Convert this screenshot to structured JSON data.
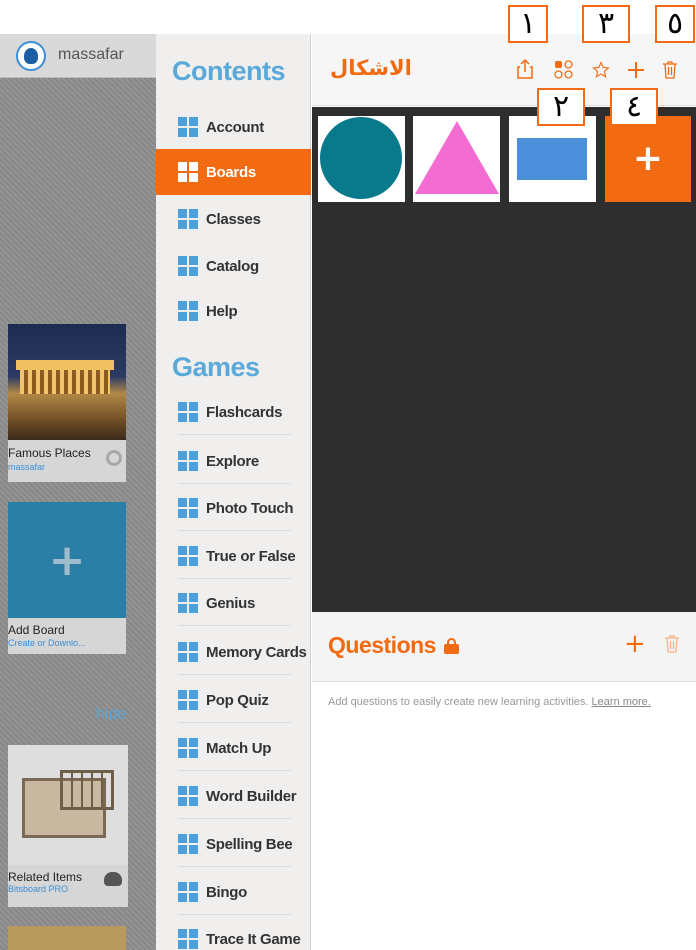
{
  "sidebar": {
    "username": "massafar",
    "boards": [
      {
        "title": "Famous Places",
        "subtitle": "massafar"
      },
      {
        "title": "Add Board",
        "subtitle": "Create or Downlo..."
      },
      {
        "title": "Related Items",
        "subtitle": "Bitsboard PRO"
      }
    ],
    "hide_label": "hide"
  },
  "menu": {
    "contents_title": "Contents",
    "contents_items": [
      {
        "label": "Account",
        "active": false
      },
      {
        "label": "Boards",
        "active": true
      },
      {
        "label": "Classes",
        "active": false
      },
      {
        "label": "Catalog",
        "active": false
      },
      {
        "label": "Help",
        "active": false
      }
    ],
    "games_title": "Games",
    "games_items": [
      {
        "label": "Flashcards"
      },
      {
        "label": "Explore"
      },
      {
        "label": "Photo Touch"
      },
      {
        "label": "True or False"
      },
      {
        "label": "Genius"
      },
      {
        "label": "Memory Cards"
      },
      {
        "label": "Pop Quiz"
      },
      {
        "label": "Match Up"
      },
      {
        "label": "Word Builder"
      },
      {
        "label": "Spelling Bee"
      },
      {
        "label": "Bingo"
      },
      {
        "label": "Trace It Game"
      }
    ]
  },
  "board": {
    "title": "الاشكال",
    "header_icons": [
      "share-icon",
      "grid-icon",
      "star-icon",
      "plus-icon",
      "trash-icon"
    ],
    "items": [
      {
        "name": "circle",
        "color": "#087a8c"
      },
      {
        "name": "triangle",
        "color": "#f36cd2"
      },
      {
        "name": "rectangle",
        "color": "#4c8fdb"
      },
      {
        "name": "add-item",
        "color": "#f26a11"
      }
    ],
    "add_symbol": "+"
  },
  "questions": {
    "title": "Questions",
    "hint": "Add questions to easily create new learning activities.",
    "learn_more": "Learn more.",
    "plus_symbol": "+"
  },
  "callouts": {
    "one": "١",
    "two": "٢",
    "three": "٣",
    "four": "٤",
    "five": "٥"
  },
  "colors": {
    "accent": "#f26a11",
    "menu_icon": "#4ba0d8",
    "section_title": "#5ba9d9",
    "canvas": "#2e2e2e"
  }
}
